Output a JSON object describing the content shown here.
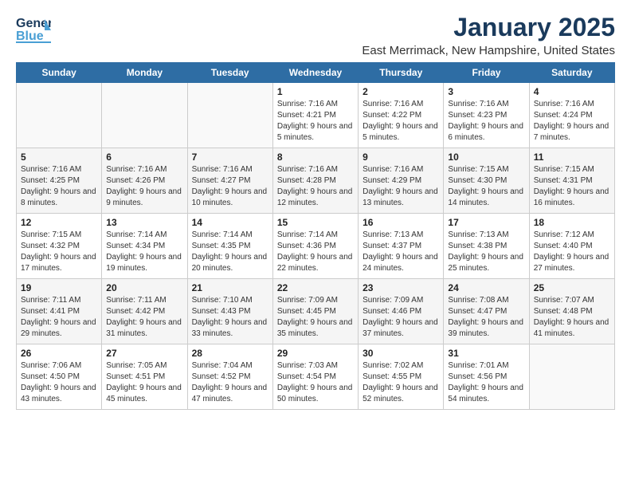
{
  "logo": {
    "line1": "General",
    "line2": "Blue"
  },
  "title": "January 2025",
  "location": "East Merrimack, New Hampshire, United States",
  "weekdays": [
    "Sunday",
    "Monday",
    "Tuesday",
    "Wednesday",
    "Thursday",
    "Friday",
    "Saturday"
  ],
  "weeks": [
    [
      {
        "day": "",
        "info": ""
      },
      {
        "day": "",
        "info": ""
      },
      {
        "day": "",
        "info": ""
      },
      {
        "day": "1",
        "info": "Sunrise: 7:16 AM\nSunset: 4:21 PM\nDaylight: 9 hours and 5 minutes."
      },
      {
        "day": "2",
        "info": "Sunrise: 7:16 AM\nSunset: 4:22 PM\nDaylight: 9 hours and 5 minutes."
      },
      {
        "day": "3",
        "info": "Sunrise: 7:16 AM\nSunset: 4:23 PM\nDaylight: 9 hours and 6 minutes."
      },
      {
        "day": "4",
        "info": "Sunrise: 7:16 AM\nSunset: 4:24 PM\nDaylight: 9 hours and 7 minutes."
      }
    ],
    [
      {
        "day": "5",
        "info": "Sunrise: 7:16 AM\nSunset: 4:25 PM\nDaylight: 9 hours and 8 minutes."
      },
      {
        "day": "6",
        "info": "Sunrise: 7:16 AM\nSunset: 4:26 PM\nDaylight: 9 hours and 9 minutes."
      },
      {
        "day": "7",
        "info": "Sunrise: 7:16 AM\nSunset: 4:27 PM\nDaylight: 9 hours and 10 minutes."
      },
      {
        "day": "8",
        "info": "Sunrise: 7:16 AM\nSunset: 4:28 PM\nDaylight: 9 hours and 12 minutes."
      },
      {
        "day": "9",
        "info": "Sunrise: 7:16 AM\nSunset: 4:29 PM\nDaylight: 9 hours and 13 minutes."
      },
      {
        "day": "10",
        "info": "Sunrise: 7:15 AM\nSunset: 4:30 PM\nDaylight: 9 hours and 14 minutes."
      },
      {
        "day": "11",
        "info": "Sunrise: 7:15 AM\nSunset: 4:31 PM\nDaylight: 9 hours and 16 minutes."
      }
    ],
    [
      {
        "day": "12",
        "info": "Sunrise: 7:15 AM\nSunset: 4:32 PM\nDaylight: 9 hours and 17 minutes."
      },
      {
        "day": "13",
        "info": "Sunrise: 7:14 AM\nSunset: 4:34 PM\nDaylight: 9 hours and 19 minutes."
      },
      {
        "day": "14",
        "info": "Sunrise: 7:14 AM\nSunset: 4:35 PM\nDaylight: 9 hours and 20 minutes."
      },
      {
        "day": "15",
        "info": "Sunrise: 7:14 AM\nSunset: 4:36 PM\nDaylight: 9 hours and 22 minutes."
      },
      {
        "day": "16",
        "info": "Sunrise: 7:13 AM\nSunset: 4:37 PM\nDaylight: 9 hours and 24 minutes."
      },
      {
        "day": "17",
        "info": "Sunrise: 7:13 AM\nSunset: 4:38 PM\nDaylight: 9 hours and 25 minutes."
      },
      {
        "day": "18",
        "info": "Sunrise: 7:12 AM\nSunset: 4:40 PM\nDaylight: 9 hours and 27 minutes."
      }
    ],
    [
      {
        "day": "19",
        "info": "Sunrise: 7:11 AM\nSunset: 4:41 PM\nDaylight: 9 hours and 29 minutes."
      },
      {
        "day": "20",
        "info": "Sunrise: 7:11 AM\nSunset: 4:42 PM\nDaylight: 9 hours and 31 minutes."
      },
      {
        "day": "21",
        "info": "Sunrise: 7:10 AM\nSunset: 4:43 PM\nDaylight: 9 hours and 33 minutes."
      },
      {
        "day": "22",
        "info": "Sunrise: 7:09 AM\nSunset: 4:45 PM\nDaylight: 9 hours and 35 minutes."
      },
      {
        "day": "23",
        "info": "Sunrise: 7:09 AM\nSunset: 4:46 PM\nDaylight: 9 hours and 37 minutes."
      },
      {
        "day": "24",
        "info": "Sunrise: 7:08 AM\nSunset: 4:47 PM\nDaylight: 9 hours and 39 minutes."
      },
      {
        "day": "25",
        "info": "Sunrise: 7:07 AM\nSunset: 4:48 PM\nDaylight: 9 hours and 41 minutes."
      }
    ],
    [
      {
        "day": "26",
        "info": "Sunrise: 7:06 AM\nSunset: 4:50 PM\nDaylight: 9 hours and 43 minutes."
      },
      {
        "day": "27",
        "info": "Sunrise: 7:05 AM\nSunset: 4:51 PM\nDaylight: 9 hours and 45 minutes."
      },
      {
        "day": "28",
        "info": "Sunrise: 7:04 AM\nSunset: 4:52 PM\nDaylight: 9 hours and 47 minutes."
      },
      {
        "day": "29",
        "info": "Sunrise: 7:03 AM\nSunset: 4:54 PM\nDaylight: 9 hours and 50 minutes."
      },
      {
        "day": "30",
        "info": "Sunrise: 7:02 AM\nSunset: 4:55 PM\nDaylight: 9 hours and 52 minutes."
      },
      {
        "day": "31",
        "info": "Sunrise: 7:01 AM\nSunset: 4:56 PM\nDaylight: 9 hours and 54 minutes."
      },
      {
        "day": "",
        "info": ""
      }
    ]
  ]
}
